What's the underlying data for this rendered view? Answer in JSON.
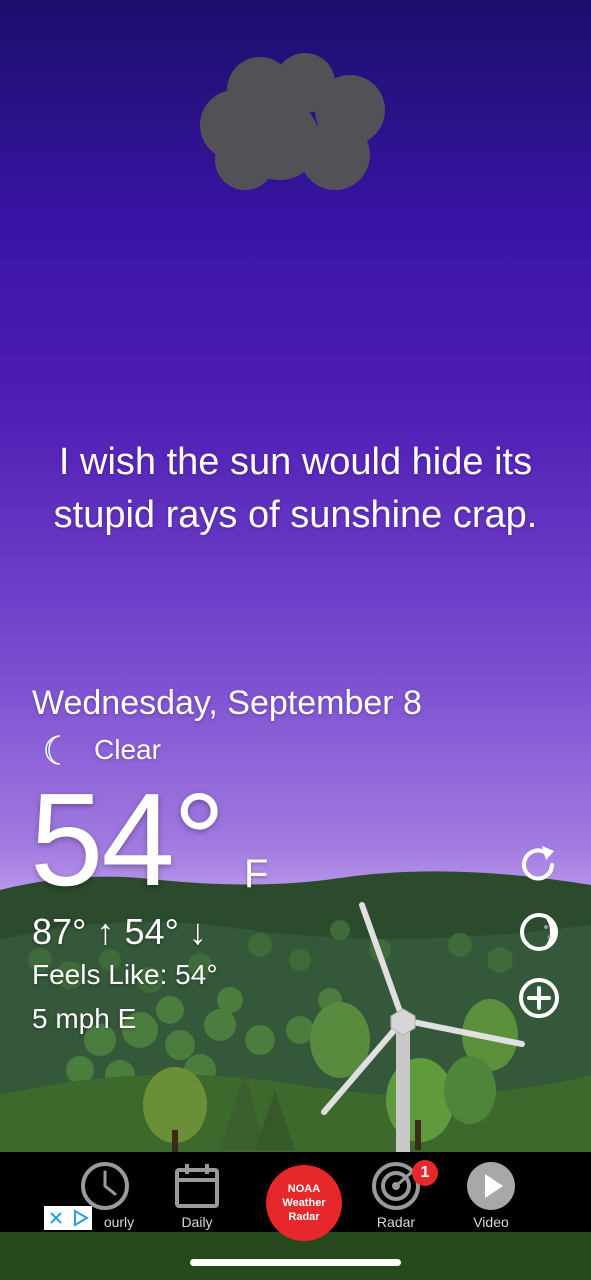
{
  "weather": {
    "quote": "I wish the sun would hide its stupid rays of sunshine crap.",
    "date": "Wednesday, September 8",
    "condition_icon": "moon-icon",
    "condition": "Clear",
    "temperature": "54°",
    "unit": "F",
    "hilo": "87° ↑ 54° ↓",
    "feels_like": "Feels Like: 54°",
    "wind": "5 mph E"
  },
  "side_actions": [
    {
      "icon": "refresh-icon"
    },
    {
      "icon": "moon-phase-icon"
    },
    {
      "icon": "add-icon"
    }
  ],
  "tabbar": {
    "tabs": [
      {
        "label": "Hourly",
        "visible_label": "ourly",
        "icon": "clock-icon"
      },
      {
        "label": "Daily",
        "icon": "calendar-icon"
      },
      {
        "label": "Radar",
        "icon": "radar-icon"
      },
      {
        "label": "Video",
        "icon": "play-icon"
      }
    ],
    "noaa_line1": "NOAA",
    "noaa_line2": "Weather",
    "noaa_line3": "Radar",
    "radar_badge": "1"
  },
  "colors": {
    "accent_red": "#e6272b",
    "tabbar_bg": "#000000"
  }
}
